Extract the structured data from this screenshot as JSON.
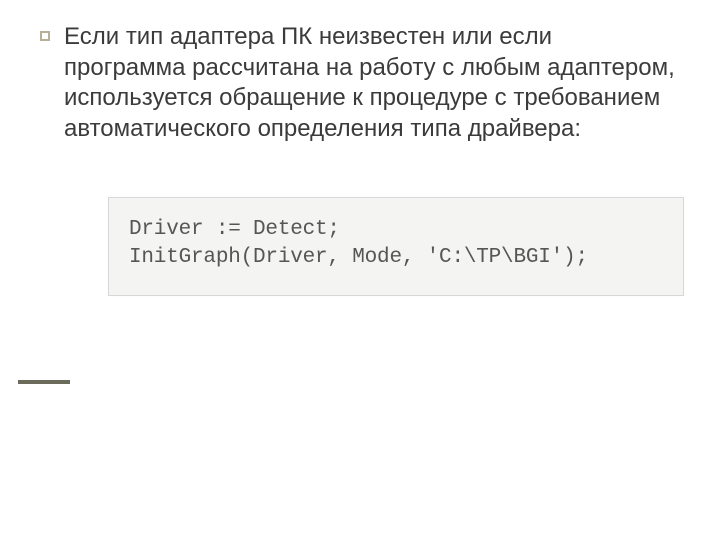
{
  "paragraph": "Если тип адаптера ПК неизвестен или если программа рассчитана на работу с любым адаптером, используется обращение к процедуре с требованием автоматического определения типа драйвера:",
  "code": {
    "line1": "Driver := Detect;",
    "line2": "InitGraph(Driver, Mode, 'C:\\TP\\BGI');"
  }
}
